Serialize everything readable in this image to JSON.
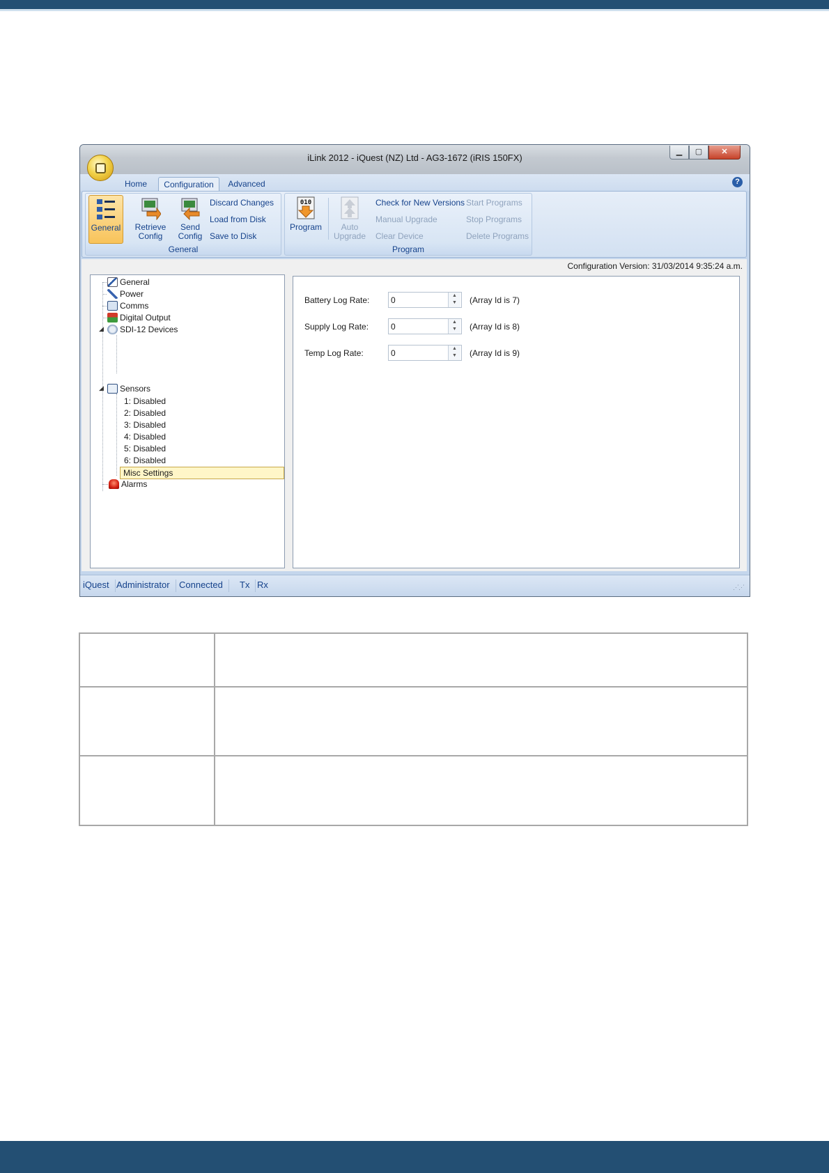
{
  "window": {
    "title": "iLink 2012 - iQuest (NZ) Ltd - AG3-1672 (iRIS 150FX)",
    "minimize_glyph": "▁",
    "maximize_glyph": "▢",
    "close_glyph": "✕",
    "help_glyph": "?"
  },
  "ribbon": {
    "tabs": [
      "Home",
      "Configuration",
      "Advanced"
    ],
    "active_tab": "Configuration",
    "groups": {
      "general": {
        "label": "General",
        "general_button": "General",
        "retrieve_config_line1": "Retrieve",
        "retrieve_config_line2": "Config",
        "send_config_line1": "Send",
        "send_config_line2": "Config",
        "discard_changes": "Discard Changes",
        "load_from_disk": "Load from Disk",
        "save_to_disk": "Save to Disk"
      },
      "program": {
        "label": "Program",
        "program_button": "Program",
        "program_icon_text": "010",
        "auto_upgrade_line1": "Auto",
        "auto_upgrade_line2": "Upgrade",
        "check_for_new_versions": "Check for New Versions",
        "manual_upgrade": "Manual Upgrade",
        "clear_device": "Clear Device",
        "start_programs": "Start Programs",
        "stop_programs": "Stop Programs",
        "delete_programs": "Delete Programs"
      }
    }
  },
  "config_version": "Configuration Version: 31/03/2014 9:35:24 a.m.",
  "tree": {
    "general": "General",
    "power": "Power",
    "comms": "Comms",
    "digital_output": "Digital Output",
    "sdi12_devices": "SDI-12 Devices",
    "sensors": "Sensors",
    "sensor_items": [
      "1: Disabled",
      "2: Disabled",
      "3: Disabled",
      "4: Disabled",
      "5: Disabled",
      "6: Disabled"
    ],
    "misc_settings": "Misc Settings",
    "alarms": "Alarms",
    "expander_glyph": "◢"
  },
  "form": {
    "battery_log_rate": {
      "label": "Battery Log Rate:",
      "value": "0",
      "note": "(Array Id is 7)"
    },
    "supply_log_rate": {
      "label": "Supply Log Rate:",
      "value": "0",
      "note": "(Array Id is 8)"
    },
    "temp_log_rate": {
      "label": "Temp Log Rate:",
      "value": "0",
      "note": "(Array Id is 9)"
    },
    "spin_up": "▲",
    "spin_down": "▼"
  },
  "status_bar": {
    "items": [
      "iQuest",
      "Administrator",
      "Connected",
      "Tx",
      "Rx"
    ],
    "grip": "⋰⋰"
  },
  "colors": {
    "page_bar": "#234f73",
    "ribbon_text": "#15428b",
    "selected_node": "#fff6c8"
  }
}
